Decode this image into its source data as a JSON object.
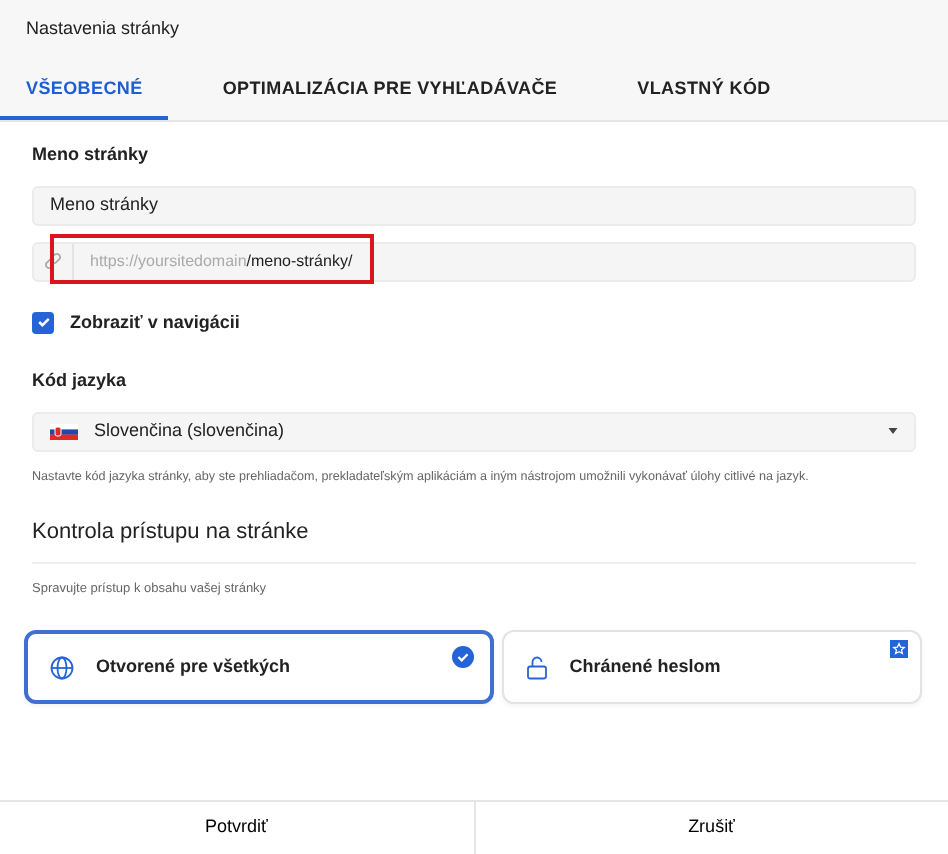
{
  "dialog": {
    "title": "Nastavenia stránky"
  },
  "tabs": [
    {
      "label": "VŠEOBECNÉ",
      "selected": true
    },
    {
      "label": "OPTIMALIZÁCIA PRE VYHĽADÁVAČE",
      "selected": false
    },
    {
      "label": "VLASTNÝ KÓD",
      "selected": false
    }
  ],
  "page_name": {
    "label": "Meno stránky",
    "value": "Meno stránky"
  },
  "url": {
    "prefix": "https://yoursitedomain",
    "path": "/meno-stránky/",
    "highlighted": true
  },
  "show_in_nav": {
    "label": "Zobraziť v navigácii",
    "checked": true
  },
  "language": {
    "label": "Kód jazyka",
    "value": "Slovenčina (slovenčina)",
    "help": "Nastavte kód jazyka stránky, aby ste prehliadačom, prekladateľským aplikáciám a iným nástrojom umožnili vykonávať úlohy citlivé na jazyk."
  },
  "access": {
    "heading": "Kontrola prístupu na stránke",
    "description": "Spravujte prístup k obsahu vašej stránky",
    "options": [
      {
        "kind": "globe",
        "label": "Otvorené pre všetkých",
        "selected": true
      },
      {
        "kind": "lock",
        "label": "Chránené heslom",
        "selected": false,
        "premium": true
      }
    ]
  },
  "buttons": [
    "Potvrdiť",
    "Zrušiť"
  ]
}
